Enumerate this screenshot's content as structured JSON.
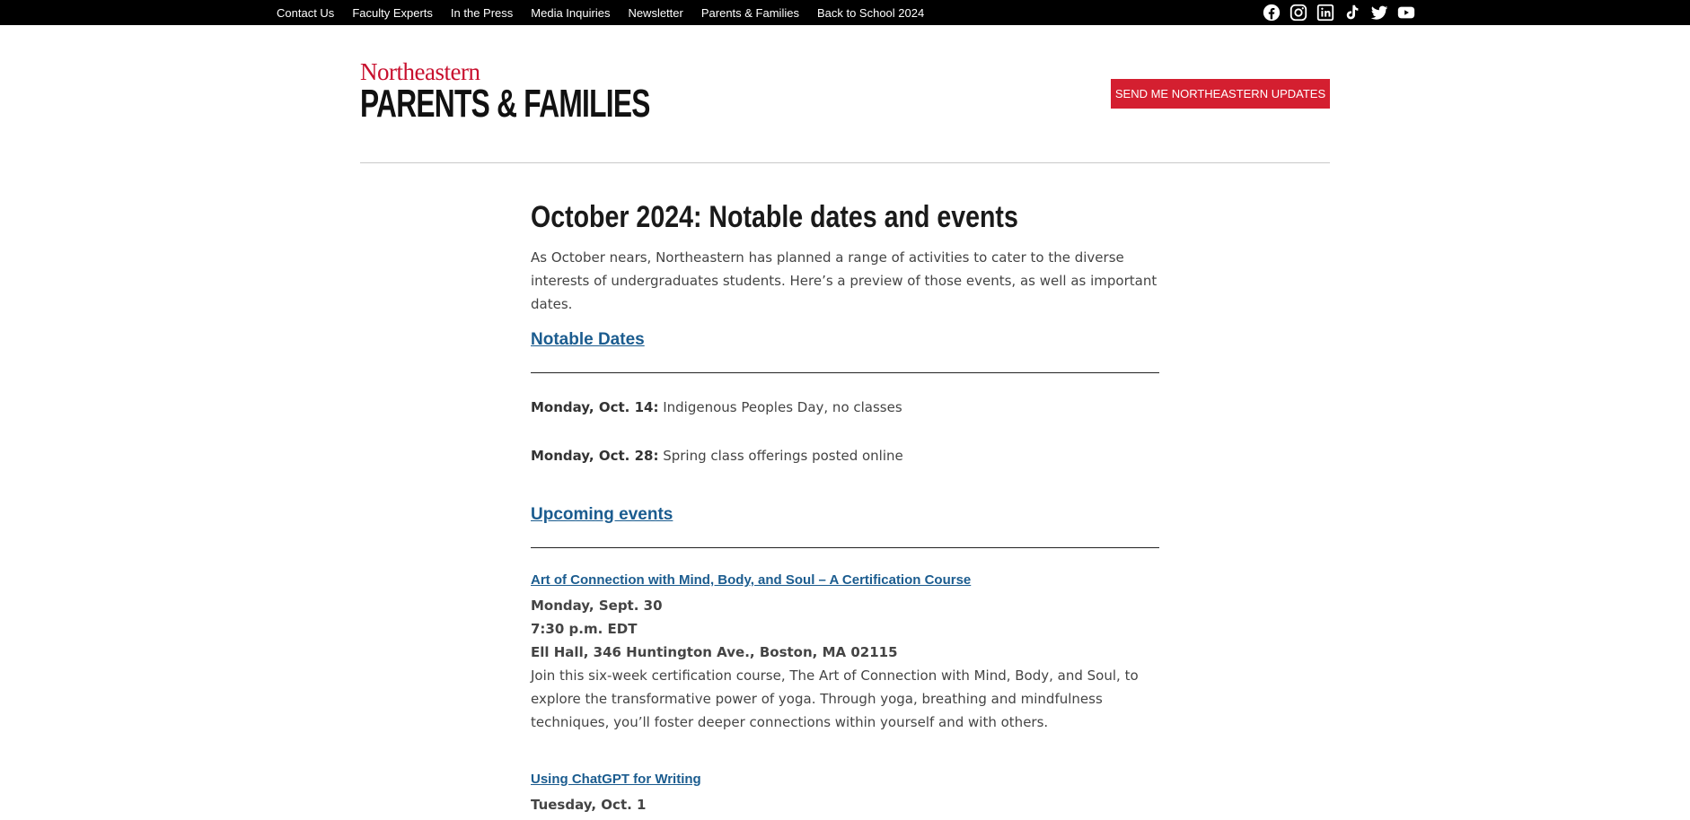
{
  "topnav": {
    "items": [
      "Contact Us",
      "Faculty Experts",
      "In the Press",
      "Media Inquiries",
      "Newsletter",
      "Parents & Families",
      "Back to School 2024"
    ]
  },
  "social": {
    "icons": [
      "facebook-icon",
      "instagram-icon",
      "linkedin-icon",
      "tiktok-icon",
      "twitter-icon",
      "youtube-icon"
    ]
  },
  "header": {
    "logo_top": "Northeastern",
    "logo_bottom": "PARENTS & FAMILIES",
    "updates_button": "SEND ME NORTHEASTERN UPDATES"
  },
  "article": {
    "title": "October 2024: Notable dates and events",
    "intro": "As October nears, Northeastern has planned a range of activities to cater to the diverse interests of undergraduates students. Here’s a preview of those events, as well as important dates.",
    "notable_heading": "Notable Dates",
    "dates": [
      {
        "label": "Monday, Oct. 14:",
        "text": " Indigenous Peoples Day, no classes"
      },
      {
        "label": "Monday, Oct. 28:",
        "text": " Spring class offerings posted online"
      }
    ],
    "events_heading": "Upcoming events",
    "events": [
      {
        "title": "Art of Connection with Mind, Body, and Soul – A Certification Course",
        "date": "Monday, Sept. 30",
        "time": "7:30 p.m. EDT",
        "location": "Ell Hall, 346 Huntington Ave., Boston, MA 02115",
        "description": "Join this six-week certification course, The Art of Connection with Mind, Body, and Soul, to explore the transformative power of yoga. Through yoga, breathing and mindfulness techniques, you’ll foster deeper connections within yourself and with others."
      },
      {
        "title": "Using ChatGPT for Writing",
        "date": "Tuesday, Oct. 1"
      }
    ]
  },
  "colors": {
    "brand_red": "#d41f30",
    "link_blue": "#1b5c8f",
    "topbar_bg": "#000000"
  }
}
